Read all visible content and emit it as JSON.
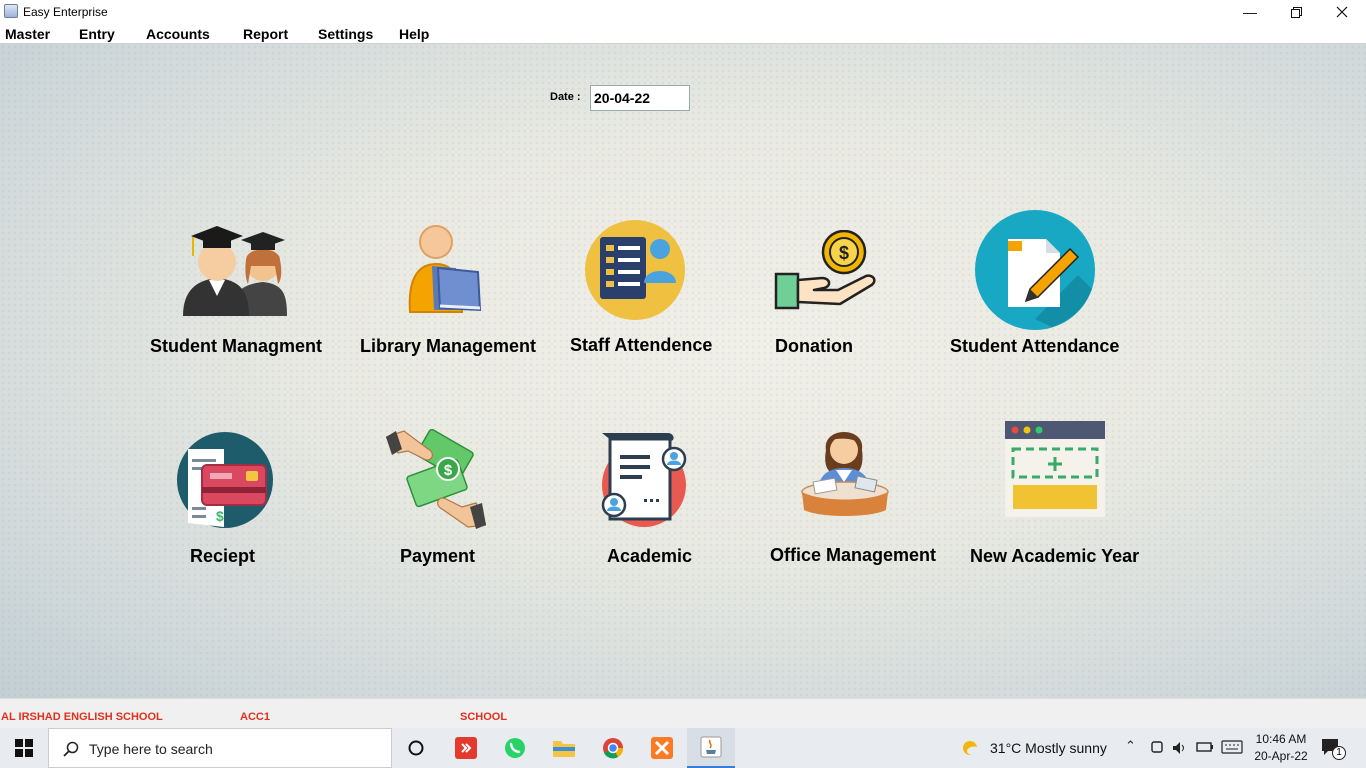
{
  "window": {
    "title": "Easy Enterprise"
  },
  "menu": [
    "Master",
    "Entry",
    "Accounts",
    "Report",
    "Settings",
    "Help"
  ],
  "date": {
    "label": "Date :",
    "value": "20-04-22"
  },
  "tiles": [
    {
      "label": "Student Managment",
      "icon": "graduates-icon"
    },
    {
      "label": "Library Management",
      "icon": "reader-book-icon"
    },
    {
      "label": "Staff Attendence",
      "icon": "checklist-person-icon"
    },
    {
      "label": "Donation",
      "icon": "hand-coin-icon"
    },
    {
      "label": "Student Attendance",
      "icon": "document-pen-icon"
    },
    {
      "label": "Reciept",
      "icon": "receipt-card-icon"
    },
    {
      "label": "Payment",
      "icon": "hands-money-icon"
    },
    {
      "label": "Academic",
      "icon": "scroll-certificate-icon"
    },
    {
      "label": "Office Management",
      "icon": "office-woman-icon"
    },
    {
      "label": "New Academic Year",
      "icon": "browser-add-icon"
    }
  ],
  "status": {
    "school": "AL IRSHAD ENGLISH SCHOOL",
    "account": "ACC1",
    "type": "SCHOOL"
  },
  "taskbar": {
    "search_placeholder": "Type here to search",
    "weather": "31°C  Mostly sunny",
    "time": "10:46 AM",
    "date": "20-Apr-22",
    "notifications": "1"
  },
  "colors": {
    "status_text": "#e0301e",
    "accent": "#3a7bd5"
  }
}
